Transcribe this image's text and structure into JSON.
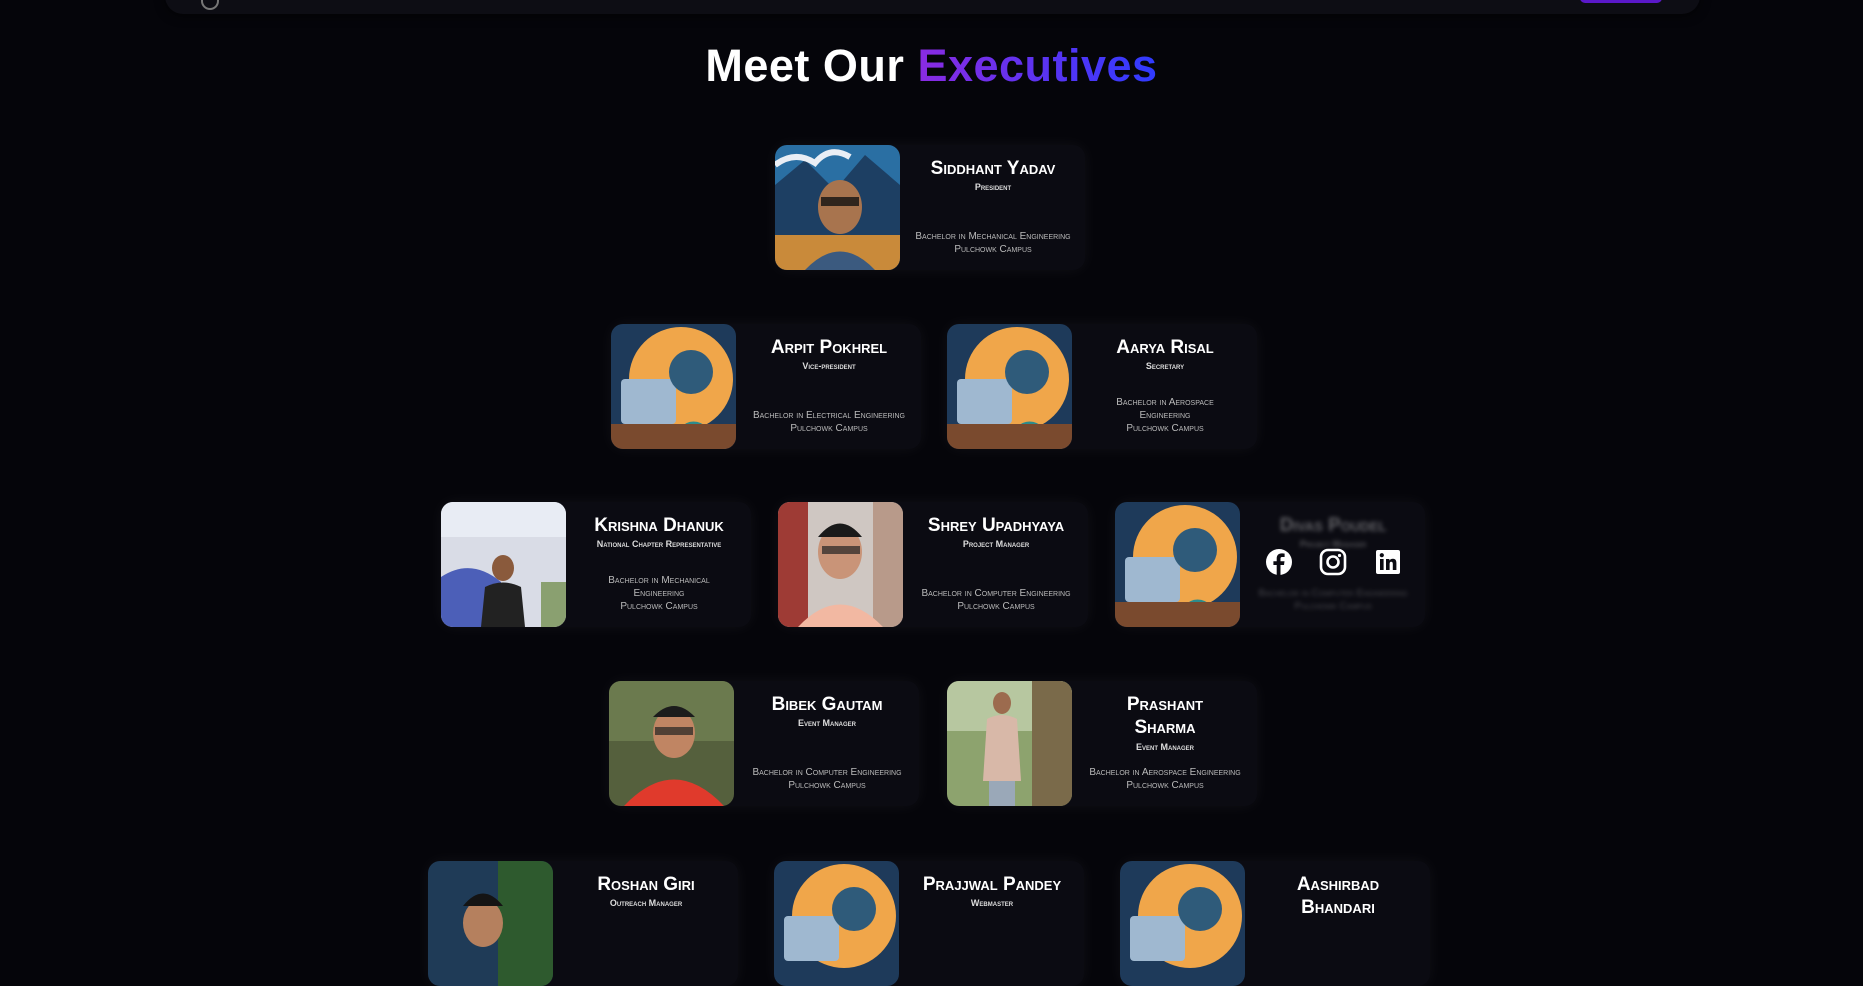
{
  "heading": {
    "part1": "Meet Our ",
    "part2": "Executives"
  },
  "members": [
    {
      "name": "Siddhant Yadav",
      "role": "President",
      "edu": "Bachelor in Mechanical Engineering",
      "campus": "Pulchowk Campus",
      "photo": "man-glasses-landscape-photo"
    },
    {
      "name": "Arpit Pokhrel",
      "role": "Vice-president",
      "edu": "Bachelor in Electrical Engineering",
      "campus": "Pulchowk Campus",
      "photo": "avatar-illustration"
    },
    {
      "name": "Aarya Risal",
      "role": "Secretary",
      "edu": "Bachelor in Aerospace Engineering",
      "campus": "Pulchowk Campus",
      "photo": "avatar-illustration"
    },
    {
      "name": "Krishna Dhanuk",
      "role": "National Chapter Representative",
      "edu": "Bachelor in Mechanical Engineering",
      "campus": "Pulchowk Campus",
      "photo": "man-suit-banner-photo"
    },
    {
      "name": "Shrey Upadhyaya",
      "role": "Project Manager",
      "edu": "Bachelor in Computer Engineering",
      "campus": "Pulchowk Campus",
      "photo": "man-glasses-photo"
    },
    {
      "name": "Divas Poudel",
      "role": "Project Manager",
      "edu": "Bachelor in Computer Engineering",
      "campus": "Pulchowk Campus",
      "photo": "avatar-illustration"
    },
    {
      "name": "Bibek Gautam",
      "role": "Event Manager",
      "edu": "Bachelor in Computer Engineering",
      "campus": "Pulchowk Campus",
      "photo": "man-red-shirt-photo"
    },
    {
      "name": "Prashant Sharma",
      "role": "Event Manager",
      "edu": "Bachelor in Aerospace Engineering",
      "campus": "Pulchowk Campus",
      "photo": "man-tree-photo"
    },
    {
      "name": "Roshan Giri",
      "role": "Outreach Manager",
      "edu": "",
      "campus": "",
      "photo": "man-outdoor-photo"
    },
    {
      "name": "Prajjwal Pandey",
      "role": "Webmaster",
      "edu": "",
      "campus": "",
      "photo": "avatar-illustration"
    },
    {
      "name": "Aashirbad Bhandari",
      "role": "",
      "edu": "",
      "campus": "",
      "photo": "avatar-illustration"
    }
  ],
  "social_icons": [
    "facebook-icon",
    "instagram-icon",
    "linkedin-icon"
  ],
  "colors": {
    "background": "#05050a",
    "card": "#0b0b12",
    "accent_start": "#8a2be2",
    "accent_end": "#2f3bff"
  }
}
